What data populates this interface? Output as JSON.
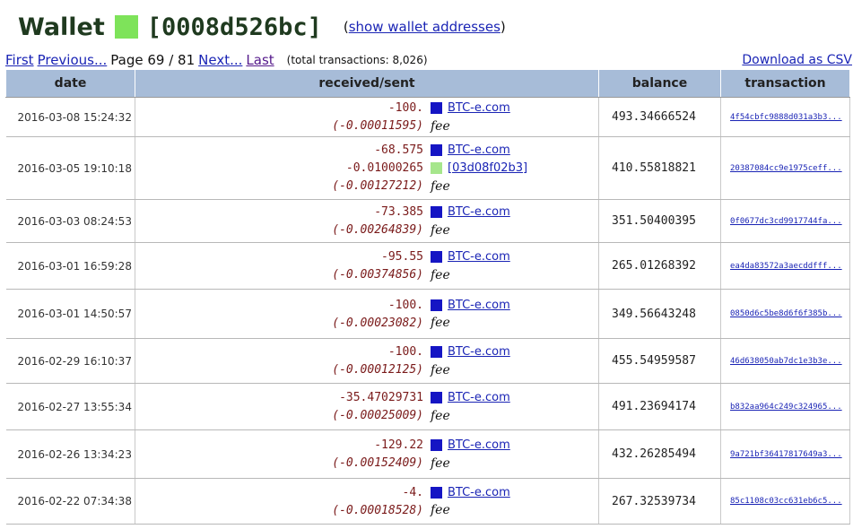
{
  "header": {
    "wallet_label": "Wallet",
    "wallet_id": "[0008d526bc]",
    "wallet_color": "#7ee35a",
    "show_addresses_open": "(",
    "show_addresses_label": "show wallet addresses",
    "show_addresses_close": ")"
  },
  "nav": {
    "first": "First",
    "previous": "Previous...",
    "page_info": "Page 69 / 81",
    "next": "Next...",
    "last": "Last",
    "total": "(total transactions: 8,026)",
    "download_csv": "Download as CSV"
  },
  "table": {
    "headers": [
      "date",
      "received/sent",
      "balance",
      "transaction"
    ],
    "rows": [
      {
        "date": "2016-03-08 15:24:32",
        "height": 44,
        "lines": [
          {
            "amount": "-100.",
            "kind": "amt",
            "swatch": "#1515c4",
            "party": "BTC-e.com"
          },
          {
            "amount": "(-0.00011595)",
            "kind": "fee",
            "label": "fee"
          }
        ],
        "balance": "493.34666524",
        "tx": "4f54cbfc9888d031a3b3..."
      },
      {
        "date": "2016-03-05 19:10:18",
        "height": 70,
        "lines": [
          {
            "amount": "-68.575",
            "kind": "amt",
            "swatch": "#1515c4",
            "party": "BTC-e.com"
          },
          {
            "amount": "-0.01000265",
            "kind": "amt",
            "swatch": "#a6e68c",
            "party": "[03d08f02b3]"
          },
          {
            "amount": "(-0.00127212)",
            "kind": "fee",
            "label": "fee"
          }
        ],
        "balance": "410.55818821",
        "tx": "20387084cc9e1975ceff..."
      },
      {
        "date": "2016-03-03 08:24:53",
        "height": 48,
        "lines": [
          {
            "amount": "-73.385",
            "kind": "amt",
            "swatch": "#1515c4",
            "party": "BTC-e.com"
          },
          {
            "amount": "(-0.00264839)",
            "kind": "fee",
            "label": "fee"
          }
        ],
        "balance": "351.50400395",
        "tx": "0f0677dc3cd9917744fa..."
      },
      {
        "date": "2016-03-01 16:59:28",
        "height": 52,
        "lines": [
          {
            "amount": "-95.55",
            "kind": "amt",
            "swatch": "#1515c4",
            "party": "BTC-e.com"
          },
          {
            "amount": "(-0.00374856)",
            "kind": "fee",
            "label": "fee"
          }
        ],
        "balance": "265.01268392",
        "tx": "ea4da83572a3aecddfff..."
      },
      {
        "date": "2016-03-01 14:50:57",
        "height": 55,
        "lines": [
          {
            "amount": "-100.",
            "kind": "amt",
            "swatch": "#1515c4",
            "party": "BTC-e.com"
          },
          {
            "amount": "(-0.00023082)",
            "kind": "fee",
            "label": "fee"
          }
        ],
        "balance": "349.56643248",
        "tx": "0850d6c5be8d6f6f385b..."
      },
      {
        "date": "2016-02-29 16:10:37",
        "height": 50,
        "lines": [
          {
            "amount": "-100.",
            "kind": "amt",
            "swatch": "#1515c4",
            "party": "BTC-e.com"
          },
          {
            "amount": "(-0.00012125)",
            "kind": "fee",
            "label": "fee"
          }
        ],
        "balance": "455.54959587",
        "tx": "46d638050ab7dc1e3b3e..."
      },
      {
        "date": "2016-02-27 13:55:34",
        "height": 52,
        "lines": [
          {
            "amount": "-35.47029731",
            "kind": "amt",
            "swatch": "#1515c4",
            "party": "BTC-e.com"
          },
          {
            "amount": "(-0.00025009)",
            "kind": "fee",
            "label": "fee"
          }
        ],
        "balance": "491.23694174",
        "tx": "b832aa964c249c324965..."
      },
      {
        "date": "2016-02-26 13:34:23",
        "height": 54,
        "lines": [
          {
            "amount": "-129.22",
            "kind": "amt",
            "swatch": "#1515c4",
            "party": "BTC-e.com"
          },
          {
            "amount": "(-0.00152409)",
            "kind": "fee",
            "label": "fee"
          }
        ],
        "balance": "432.26285494",
        "tx": "9a721bf36417817649a3..."
      },
      {
        "date": "2016-02-22 07:34:38",
        "height": 51,
        "lines": [
          {
            "amount": "-4.",
            "kind": "amt",
            "swatch": "#1515c4",
            "party": "BTC-e.com"
          },
          {
            "amount": "(-0.00018528)",
            "kind": "fee",
            "label": "fee"
          }
        ],
        "balance": "267.32539734",
        "tx": "85c1108c03cc631eb6c5..."
      }
    ]
  }
}
